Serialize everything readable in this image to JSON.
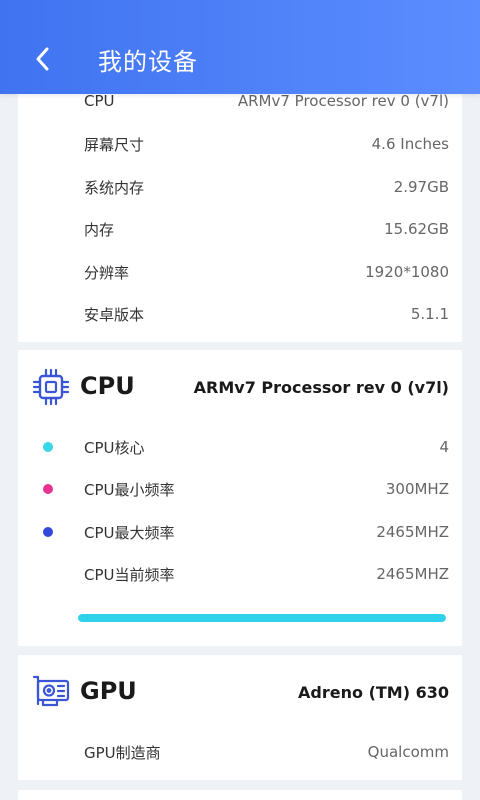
{
  "header": {
    "title": "我的设备"
  },
  "device_info": {
    "rows": [
      {
        "label": "CPU",
        "value": "ARMv7 Processor rev 0 (v7l)"
      },
      {
        "label": "屏幕尺寸",
        "value": "4.6 Inches"
      },
      {
        "label": "系统内存",
        "value": "2.97GB"
      },
      {
        "label": "内存",
        "value": "15.62GB"
      },
      {
        "label": "分辨率",
        "value": "1920*1080"
      },
      {
        "label": "安卓版本",
        "value": "5.1.1"
      }
    ]
  },
  "cpu": {
    "title": "CPU",
    "model": "ARMv7 Processor rev 0 (v7l)",
    "rows": [
      {
        "label": "CPU核心",
        "value": "4",
        "dot_color": "#38d6e8"
      },
      {
        "label": "CPU最小频率",
        "value": "300MHZ",
        "dot_color": "#e8348f"
      },
      {
        "label": "CPU最大频率",
        "value": "2465MHZ",
        "dot_color": "#3347d8"
      },
      {
        "label": "CPU当前频率",
        "value": "2465MHZ"
      }
    ],
    "load_fraction": 1.0
  },
  "gpu": {
    "title": "GPU",
    "model": "Adreno (TM) 630",
    "rows": [
      {
        "label": "GPU制造商",
        "value": "Qualcomm"
      }
    ]
  },
  "colors": {
    "header_start": "#3f73f0",
    "header_end": "#5c8dff",
    "accent_icon": "#3a55d6",
    "progress_fill": "#2fd2ea"
  },
  "icons": {
    "back": "chevron-left-icon",
    "cpu": "cpu-chip-icon",
    "gpu": "graphics-card-icon"
  }
}
